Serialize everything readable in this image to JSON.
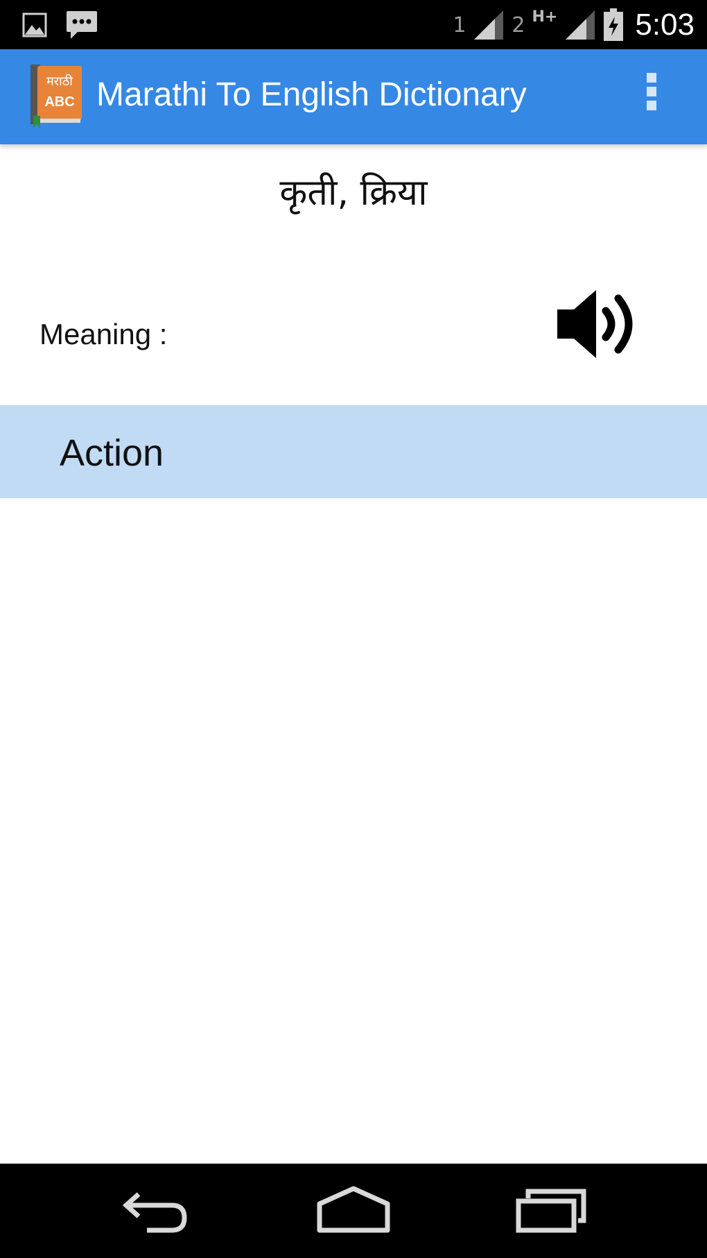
{
  "status_bar": {
    "icons": [
      "gallery-icon",
      "chat-icon"
    ],
    "sim1_label": "1",
    "sim2_label": "2",
    "network_type": "H+",
    "time": "5:03"
  },
  "app_bar": {
    "logo_text_top": "मराठी",
    "logo_text_bottom": "ABC",
    "title": "Marathi To English Dictionary",
    "menu_icon": "overflow-menu-icon"
  },
  "entry": {
    "word": "कृती, क्रिया",
    "meaning_label": "Meaning :",
    "speaker_icon": "speaker-icon",
    "meaning": "Action"
  },
  "nav_bar": {
    "icons": [
      "back-icon",
      "home-icon",
      "recents-icon"
    ]
  },
  "colors": {
    "app_bar": "#3588e4",
    "meaning_row": "#c2dbf5",
    "logo_orange": "#e8843a"
  }
}
